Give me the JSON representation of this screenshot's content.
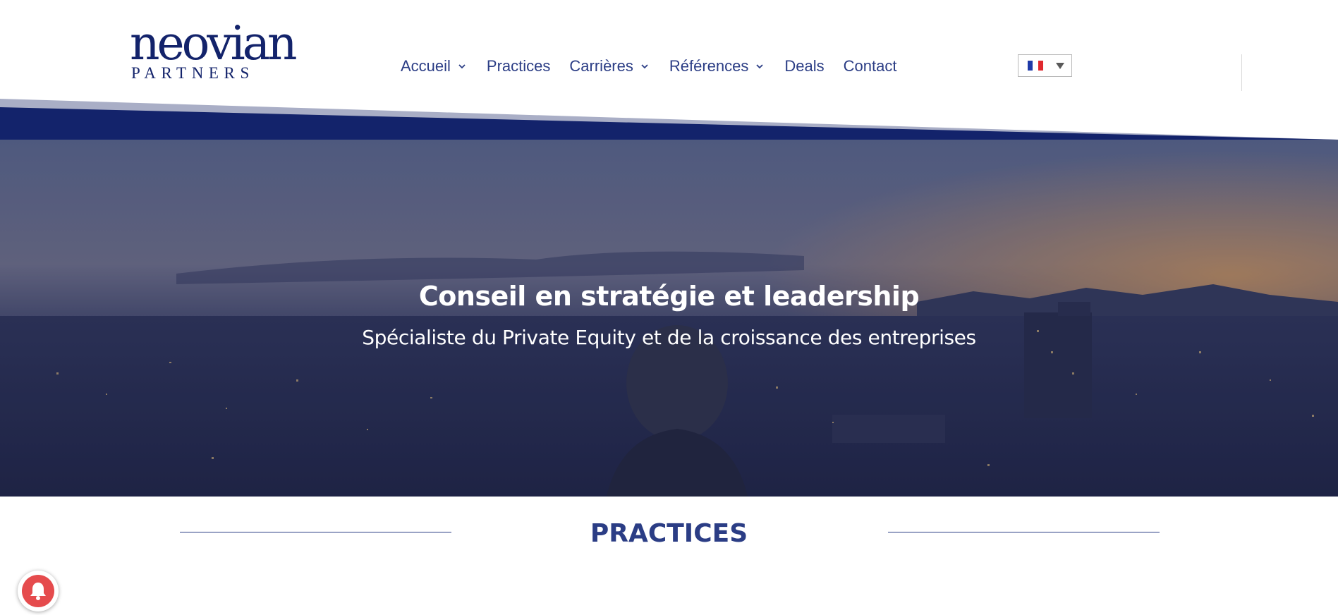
{
  "brand": {
    "logo_word": "neovian",
    "logo_sub": "PARTNERS"
  },
  "nav": {
    "items": [
      {
        "label": "Accueil",
        "has_dropdown": true
      },
      {
        "label": "Practices",
        "has_dropdown": false
      },
      {
        "label": "Carrières",
        "has_dropdown": true
      },
      {
        "label": "Références",
        "has_dropdown": true
      },
      {
        "label": "Deals",
        "has_dropdown": false
      },
      {
        "label": "Contact",
        "has_dropdown": false
      }
    ]
  },
  "language": {
    "selected_icon": "french-flag-icon"
  },
  "hero": {
    "title": "Conseil en stratégie et leadership",
    "subtitle": "Spécialiste du Private Equity et de la croissance des entreprises"
  },
  "section": {
    "title": "PRACTICES"
  },
  "notification": {
    "icon": "bell-icon"
  },
  "colors": {
    "brand_navy": "#13236b",
    "nav_text": "#2b3d85",
    "notification_red": "#e54b4d"
  }
}
